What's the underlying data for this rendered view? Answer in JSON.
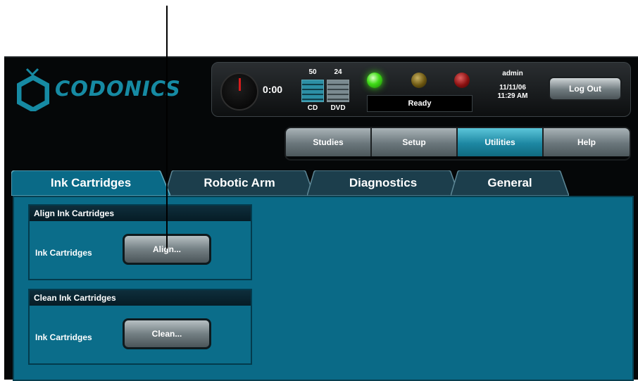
{
  "app": {
    "logo_text": "CODONICS"
  },
  "status": {
    "timer": "0:00",
    "cd_count": "50",
    "cd_label": "CD",
    "dvd_count": "24",
    "dvd_label": "DVD",
    "ready_text": "Ready",
    "user": "admin",
    "date": "11/11/06",
    "time": "11:29 AM",
    "logout_label": "Log Out",
    "colors": {
      "green": "#3fdc17",
      "amber": "#6a5510",
      "red": "#8a1010"
    }
  },
  "nav": {
    "items": [
      {
        "label": "Studies"
      },
      {
        "label": "Setup"
      },
      {
        "label": "Utilities"
      },
      {
        "label": "Help"
      }
    ],
    "active": "Utilities"
  },
  "tabs": {
    "items": [
      {
        "label": "Ink Cartridges"
      },
      {
        "label": "Robotic Arm"
      },
      {
        "label": "Diagnostics"
      },
      {
        "label": "General"
      }
    ],
    "active": "Ink Cartridges"
  },
  "content": {
    "align": {
      "title": "Align Ink Cartridges",
      "label": "Ink Cartridges",
      "button": "Align..."
    },
    "clean": {
      "title": "Clean Ink Cartridges",
      "label": "Ink Cartridges",
      "button": "Clean..."
    }
  },
  "theme": {
    "accent": "#0a6a87",
    "brand": "#168aa3"
  }
}
